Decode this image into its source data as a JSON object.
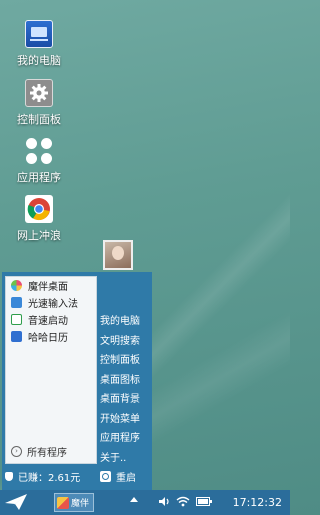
{
  "desktop": {
    "icons": [
      {
        "label": "我的电脑",
        "icon": "computer-icon"
      },
      {
        "label": "控制面板",
        "icon": "gear-icon"
      },
      {
        "label": "应用程序",
        "icon": "apps-grid-icon"
      },
      {
        "label": "网上冲浪",
        "icon": "chrome-icon"
      }
    ]
  },
  "start_menu": {
    "programs": [
      {
        "label": "魔伴桌面",
        "icon": "pinwheel-icon",
        "color": "#e94e77"
      },
      {
        "label": "光速输入法",
        "icon": "ime-g-icon",
        "color": "#3a88d8"
      },
      {
        "label": "音速启动",
        "icon": "v-launcher-icon",
        "color": "#2f9e4c"
      },
      {
        "label": "哈哈日历",
        "icon": "calendar-icon",
        "color": "#2f6fd0"
      }
    ],
    "all_programs": "所有程序",
    "shortcuts": [
      "我的电脑",
      "文明搜索",
      "控制面板",
      "桌面图标",
      "桌面背景",
      "开始菜单",
      "应用程序",
      "关于.."
    ],
    "earned": "已赚：2.61元",
    "restart": "重启"
  },
  "taskbar": {
    "task_label": "魔伴",
    "clock": "17:12:32"
  },
  "colors": {
    "menu_blue": "#2f7aa8",
    "taskbar_blue": "#2b6d9b"
  }
}
